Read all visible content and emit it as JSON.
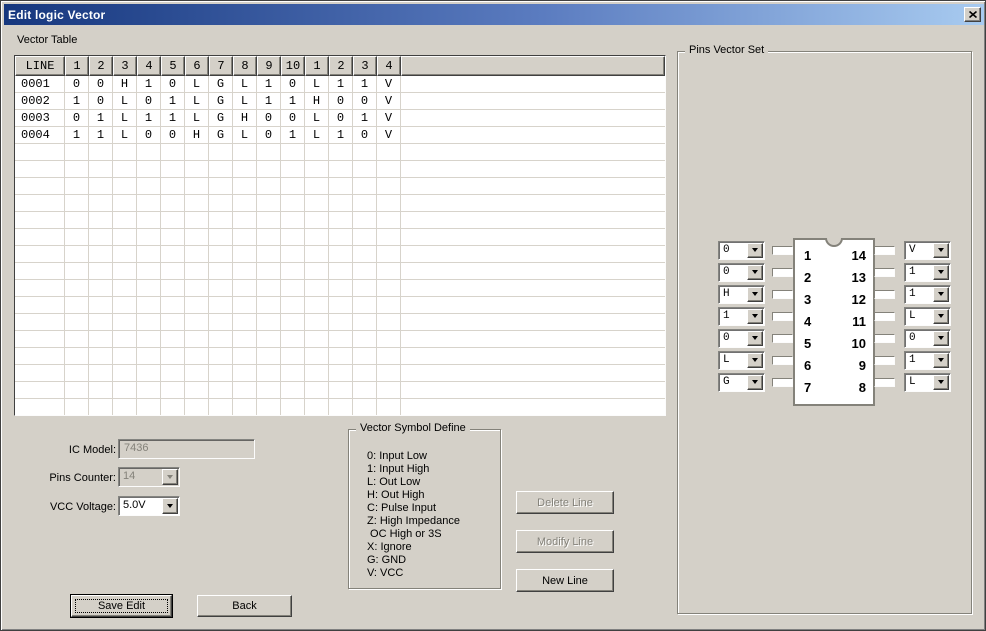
{
  "window": {
    "title": "Edit logic Vector",
    "close_icon": "close-x"
  },
  "colors": {
    "dialog_bg": "#d4d0c8",
    "titlebar_left": "#16377e",
    "titlebar_right": "#a8cbf0",
    "disabled_text": "#84827a",
    "table_grid": "#d7d3cb"
  },
  "vector_table": {
    "label": "Vector Table",
    "columns": [
      "LINE",
      "1",
      "2",
      "3",
      "4",
      "5",
      "6",
      "7",
      "8",
      "9",
      "10",
      "1",
      "2",
      "3",
      "4"
    ],
    "rows": [
      [
        "0001",
        "0",
        "0",
        "H",
        "1",
        "0",
        "L",
        "G",
        "L",
        "1",
        "0",
        "L",
        "1",
        "1",
        "V"
      ],
      [
        "0002",
        "1",
        "0",
        "L",
        "0",
        "1",
        "L",
        "G",
        "L",
        "1",
        "1",
        "H",
        "0",
        "0",
        "V"
      ],
      [
        "0003",
        "0",
        "1",
        "L",
        "1",
        "1",
        "L",
        "G",
        "H",
        "0",
        "0",
        "L",
        "0",
        "1",
        "V"
      ],
      [
        "0004",
        "1",
        "1",
        "L",
        "0",
        "0",
        "H",
        "G",
        "L",
        "0",
        "1",
        "L",
        "1",
        "0",
        "V"
      ]
    ]
  },
  "form": {
    "ic_model_label": "IC Model:",
    "ic_model_value": "7436",
    "pins_counter_label": "Pins Counter:",
    "pins_counter_value": "14",
    "vcc_voltage_label": "VCC Voltage:",
    "vcc_voltage_value": "5.0V"
  },
  "symbol_define": {
    "title": "Vector Symbol Define",
    "lines": [
      "0: Input Low",
      "1: Input High",
      "L: Out Low",
      "H: Out High",
      "C: Pulse Input",
      "Z: High Impedance",
      " OC High or 3S",
      "X: Ignore",
      "G: GND",
      "V: VCC"
    ]
  },
  "buttons": {
    "delete_line": "Delete Line",
    "modify_line": "Modify Line",
    "new_line": "New Line",
    "save_edit": "Save Edit",
    "back": "Back"
  },
  "pins_vector_set": {
    "title": "Pins Vector Set",
    "left_pins": [
      {
        "pin": "1",
        "value": "0"
      },
      {
        "pin": "2",
        "value": "0"
      },
      {
        "pin": "3",
        "value": "H"
      },
      {
        "pin": "4",
        "value": "1"
      },
      {
        "pin": "5",
        "value": "0"
      },
      {
        "pin": "6",
        "value": "L"
      },
      {
        "pin": "7",
        "value": "G"
      }
    ],
    "right_pins": [
      {
        "pin": "14",
        "value": "V"
      },
      {
        "pin": "13",
        "value": "1"
      },
      {
        "pin": "12",
        "value": "1"
      },
      {
        "pin": "11",
        "value": "L"
      },
      {
        "pin": "10",
        "value": "0"
      },
      {
        "pin": "9",
        "value": "1"
      },
      {
        "pin": "8",
        "value": "L"
      }
    ]
  }
}
